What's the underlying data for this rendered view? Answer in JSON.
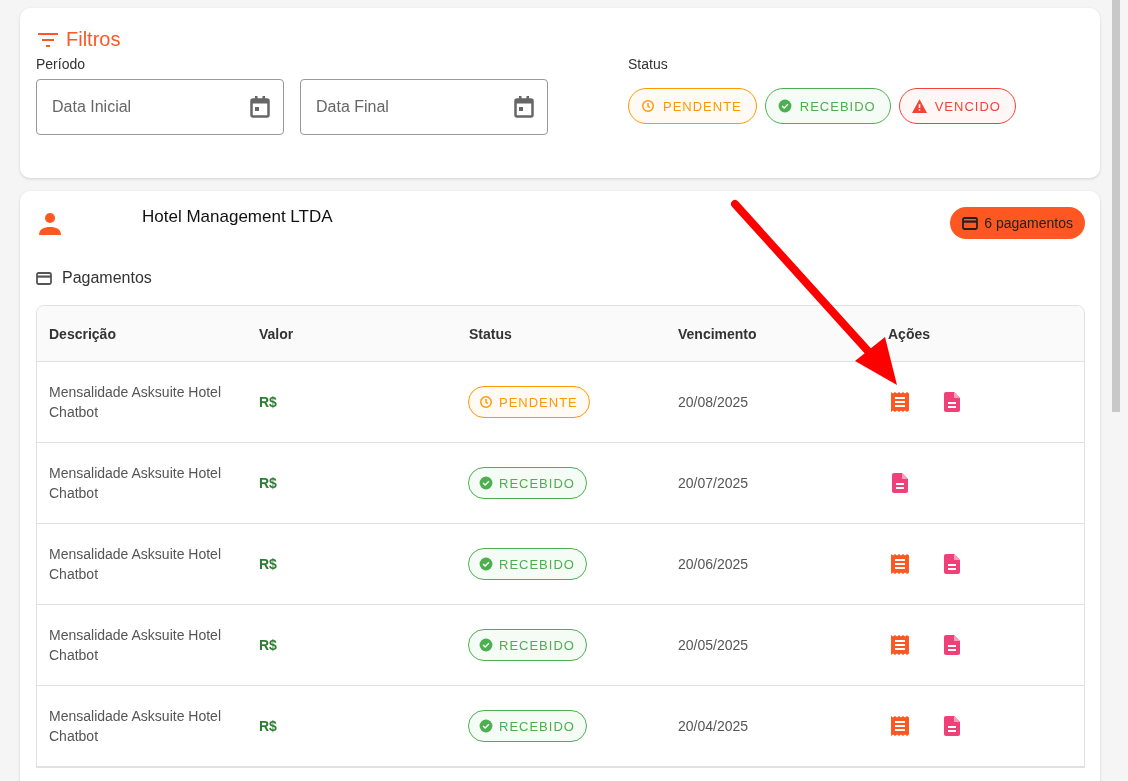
{
  "filters": {
    "title": "Filtros",
    "period_label": "Período",
    "date_fields": [
      {
        "placeholder": "Data Inicial"
      },
      {
        "placeholder": "Data Final"
      }
    ],
    "status_label": "Status",
    "status_chips": [
      {
        "kind": "pending",
        "label": "PENDENTE"
      },
      {
        "kind": "received",
        "label": "RECEBIDO"
      },
      {
        "kind": "overdue",
        "label": "VENCIDO"
      }
    ]
  },
  "client": {
    "name": "Hotel Management LTDA",
    "badge": "6 pagamentos",
    "section_title": "Pagamentos",
    "table": {
      "columns": [
        "Descrição",
        "Valor",
        "Status",
        "Vencimento",
        "Ações"
      ],
      "rows": [
        {
          "description": "Mensalidade Asksuite Hotel Chatbot",
          "value": "R$",
          "status": {
            "kind": "pending",
            "label": "PENDENTE"
          },
          "due": "20/08/2025",
          "has_receipt": true
        },
        {
          "description": "Mensalidade Asksuite Hotel Chatbot",
          "value": "R$",
          "status": {
            "kind": "received",
            "label": "RECEBIDO"
          },
          "due": "20/07/2025",
          "has_receipt": false
        },
        {
          "description": "Mensalidade Asksuite Hotel Chatbot",
          "value": "R$",
          "status": {
            "kind": "received",
            "label": "RECEBIDO"
          },
          "due": "20/06/2025",
          "has_receipt": true
        },
        {
          "description": "Mensalidade Asksuite Hotel Chatbot",
          "value": "R$",
          "status": {
            "kind": "received",
            "label": "RECEBIDO"
          },
          "due": "20/05/2025",
          "has_receipt": true
        },
        {
          "description": "Mensalidade Asksuite Hotel Chatbot",
          "value": "R$",
          "status": {
            "kind": "received",
            "label": "RECEBIDO"
          },
          "due": "20/04/2025",
          "has_receipt": true
        }
      ]
    }
  }
}
